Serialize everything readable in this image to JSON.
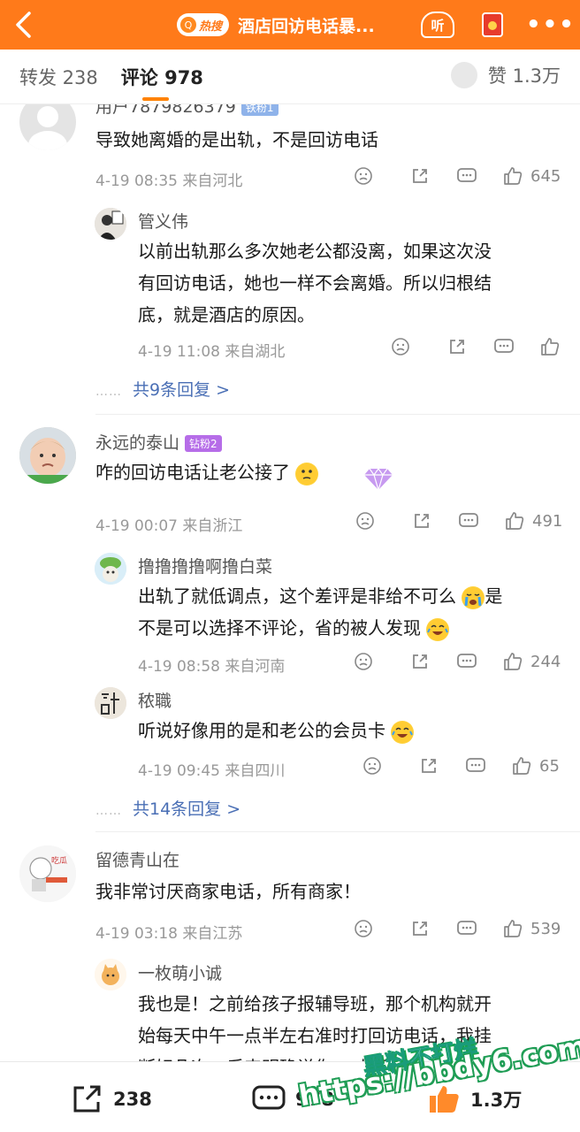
{
  "topbar": {
    "back_icon": "back-arrow-icon",
    "hot_label": "热搜",
    "title": "酒店回访电话暴...",
    "listen_label": "听",
    "accent": "#ff7a1a"
  },
  "tabs": {
    "repost": "转发 238",
    "comment": "评论 978",
    "likes": "赞 1.3万"
  },
  "comments": [
    {
      "name": "用户7879826379",
      "badge": "铁粉1",
      "text": "导致她离婚的是出轨，不是回访电话",
      "meta": "4-19 08:35 来自河北",
      "likes": "645",
      "replies": [
        {
          "name": "管义伟",
          "lines": [
            "以前出轨那么多次她老公都没离，如果这次没",
            "有回访电话，她也一样不会离婚。所以归根结",
            "底，就是酒店的原因。"
          ],
          "meta": "4-19 11:08 来自湖北",
          "likes": ""
        }
      ],
      "more": "共9条回复 >"
    },
    {
      "name": "永远的泰山",
      "badge": "钻粉2",
      "text": "咋的回访电话让老公接了",
      "meta": "4-19 00:07 来自浙江",
      "likes": "491",
      "replies": [
        {
          "name": "撸撸撸撸啊撸白菜",
          "lines": [
            "出轨了就低调点，这个差评是非给不可么",
            "不是可以选择不评论，省的被人发现"
          ],
          "line1_tail": "是",
          "meta": "4-19 08:58 来自河南",
          "likes": "244"
        },
        {
          "name": "秾職",
          "lines": [
            "听说好像用的是和老公的会员卡"
          ],
          "meta": "4-19 09:45 来自四川",
          "likes": "65"
        }
      ],
      "more": "共14条回复 >"
    },
    {
      "name": "留德青山在",
      "text": "我非常讨厌商家电话，所有商家！",
      "meta": "4-19 03:18 来自江苏",
      "likes": "539",
      "replies": [
        {
          "name": "一枚萌小诚",
          "lines": [
            "我也是！之前给孩子报辅导班，那个机构就开",
            "始每天中午一点半左右准时打回访电话，我挂",
            "断好几次，后来明确说你... 上班"
          ]
        }
      ]
    }
  ],
  "bottom": {
    "repost": "238",
    "comment": "978",
    "like": "1.3万"
  },
  "watermark": {
    "line1": "黑料不打烊",
    "line2": "https://bbdy6.com"
  }
}
